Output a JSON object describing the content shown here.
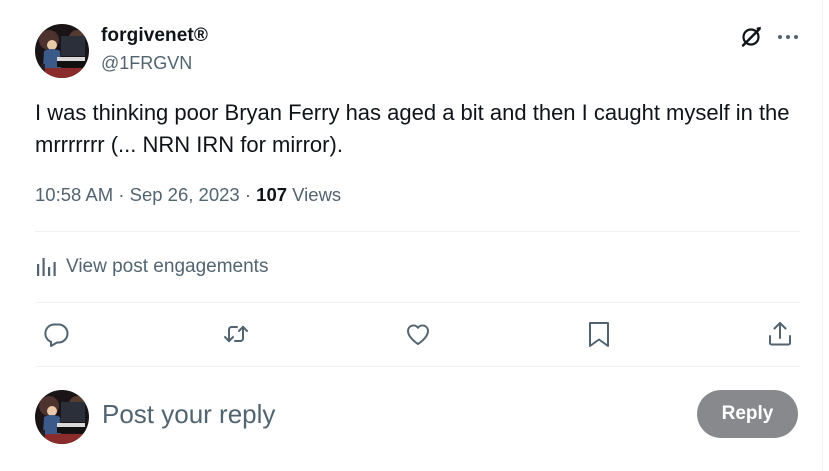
{
  "post": {
    "author": {
      "display_name": "forgivenet®",
      "handle": "@1FRGVN",
      "avatar_icon": "avatar-pianist-image"
    },
    "text": "I was thinking poor Bryan Ferry has aged a bit and then I caught myself in the mrrrrrrr (... NRN IRN for mirror).",
    "time": "10:58 AM",
    "date": "Sep 26, 2023",
    "separator": "·",
    "views_count": "107",
    "views_label": "Views"
  },
  "header_icons": [
    "grok-icon",
    "more-icon"
  ],
  "engagements": {
    "label": "View post engagements",
    "icon": "analytics-bar-icon"
  },
  "actions": [
    "reply-icon",
    "repost-icon",
    "like-icon",
    "bookmark-icon",
    "share-icon"
  ],
  "reply_composer": {
    "placeholder": "Post your reply",
    "button_label": "Reply"
  },
  "colors": {
    "text_primary": "#0f1419",
    "text_secondary": "#536471",
    "divider": "#eff3f4",
    "reply_button_disabled": "#87898c"
  }
}
